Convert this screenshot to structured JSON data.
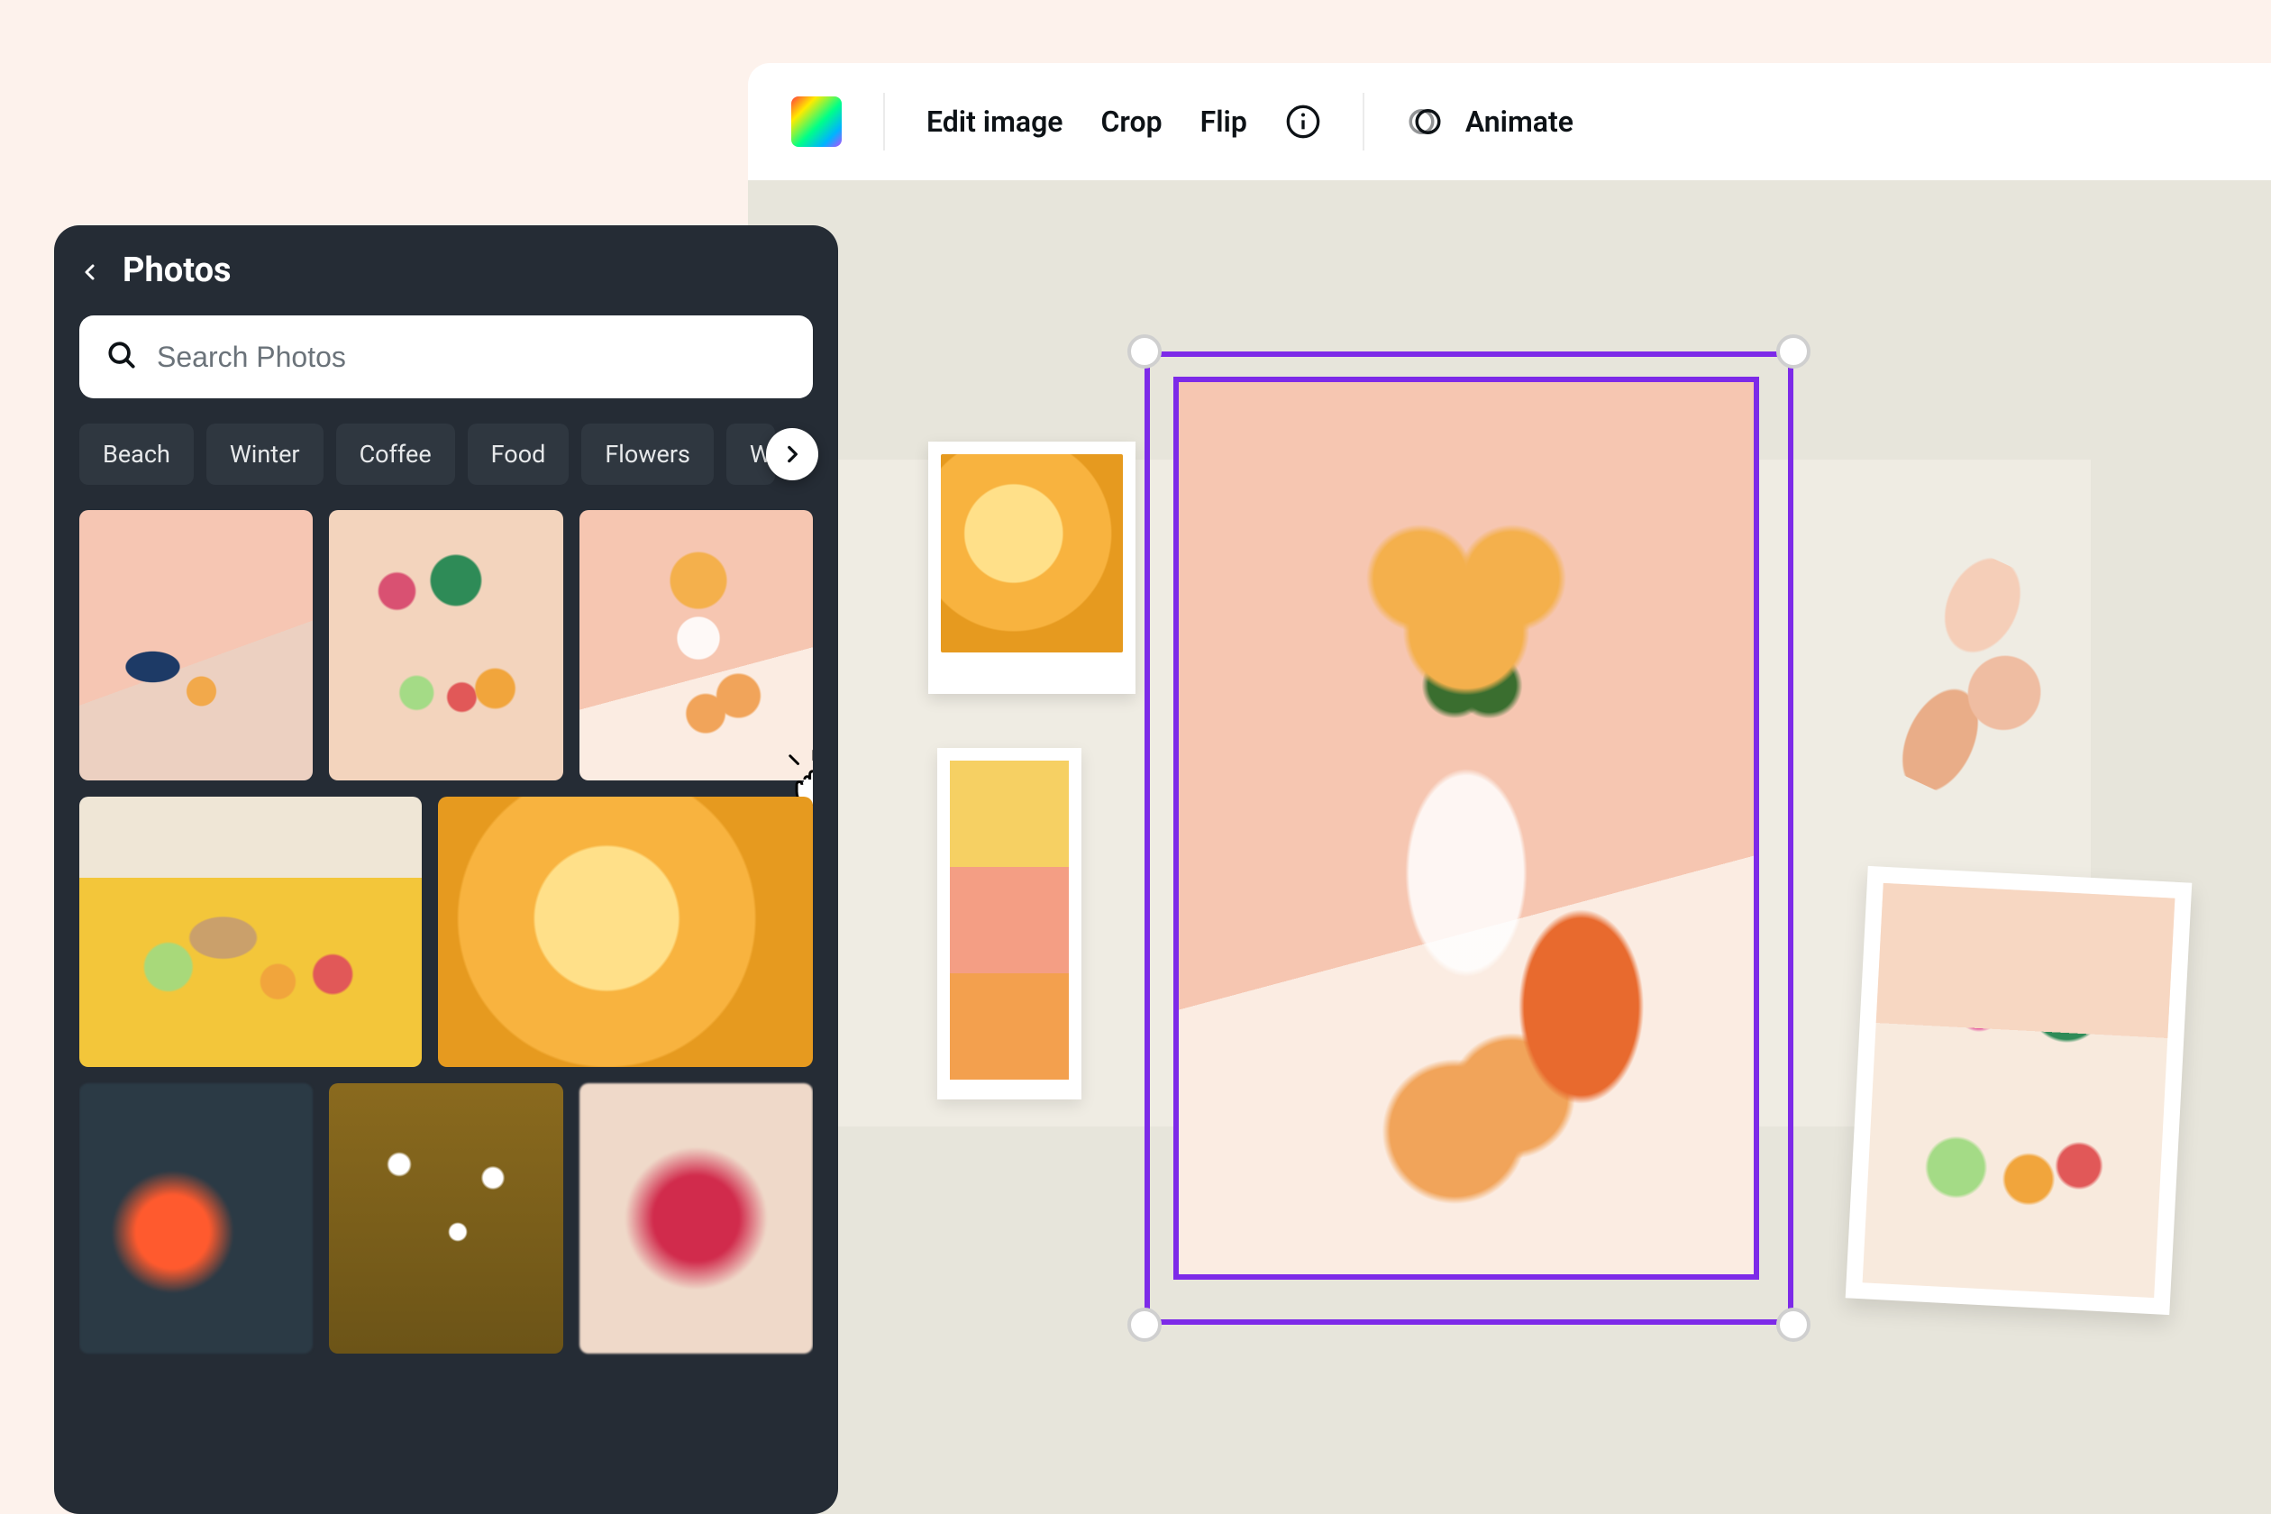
{
  "toolbar": {
    "color_swatch": "color-picker",
    "edit_image": "Edit image",
    "crop": "Crop",
    "flip": "Flip",
    "info_icon": "info",
    "animate_icon": "animate",
    "animate": "Animate"
  },
  "photos_panel": {
    "title": "Photos",
    "back_icon": "chevron-left",
    "search": {
      "placeholder": "Search Photos",
      "value": "",
      "icon": "search"
    },
    "chips": [
      "Beach",
      "Winter",
      "Coffee",
      "Food",
      "Flowers",
      "W"
    ],
    "chips_more_icon": "chevron-right",
    "grid": {
      "row1": [
        {
          "name": "photo-pink-papaya"
        },
        {
          "name": "photo-fruit-table"
        },
        {
          "name": "photo-vase-peaches"
        }
      ],
      "row2": [
        {
          "name": "photo-picnic-yellow"
        },
        {
          "name": "photo-yellow-bloom"
        }
      ],
      "row3": [
        {
          "name": "photo-blur-orange"
        },
        {
          "name": "photo-daisies"
        },
        {
          "name": "photo-blur-pink"
        }
      ]
    },
    "drag_cursor": "grab-hand"
  },
  "canvas": {
    "palette": [
      "#f6d063",
      "#f49e84",
      "#f3a04e"
    ],
    "selection_color": "#7d2ae8",
    "selected_image": "photo-vase-peaches",
    "polaroid_image": "photo-yellow-bloom",
    "moodboard_image": "photo-fruit-table",
    "brushstroke": "peach-brushstroke"
  }
}
